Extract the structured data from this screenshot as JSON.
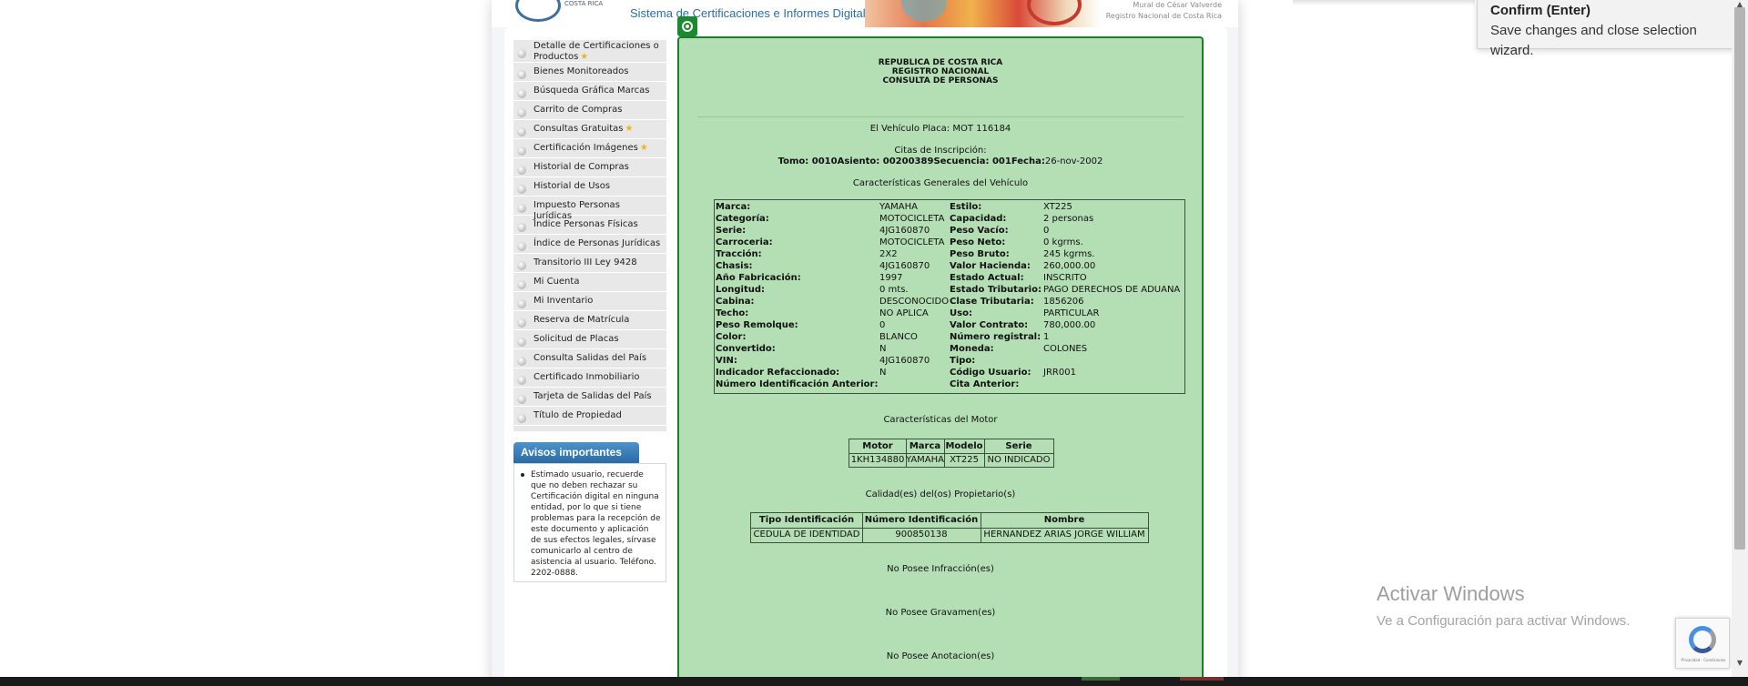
{
  "header": {
    "costa_rica": "COSTA RICA",
    "title": "Sistema de Certificaciones e Informes Digitales",
    "mural_line1": "Mural de César Valverde",
    "mural_line2": "Registro Nacional de Costa Rica"
  },
  "sidebar": {
    "items": [
      {
        "label": "Detalle de Certificaciones o Productos",
        "star": true
      },
      {
        "label": "Bienes Monitoreados",
        "star": false
      },
      {
        "label": "Búsqueda Gráfica Marcas",
        "star": false
      },
      {
        "label": "Carrito de Compras",
        "star": false
      },
      {
        "label": "Consultas Gratuitas",
        "star": true
      },
      {
        "label": "Certificación Imágenes",
        "star": true
      },
      {
        "label": "Historial de Compras",
        "star": false
      },
      {
        "label": "Historial de Usos",
        "star": false
      },
      {
        "label": "Impuesto Personas Jurídicas",
        "star": false
      },
      {
        "label": "Índice Personas Físicas",
        "star": false
      },
      {
        "label": "Índice de Personas Jurídicas",
        "star": false
      },
      {
        "label": "Transitorio III Ley 9428",
        "star": false
      },
      {
        "label": "Mi Cuenta",
        "star": false
      },
      {
        "label": "Mi Inventario",
        "star": false
      },
      {
        "label": "Reserva de Matrícula",
        "star": false
      },
      {
        "label": "Solicitud de Placas",
        "star": false
      },
      {
        "label": "Consulta Salidas del País",
        "star": false
      },
      {
        "label": "Certificado Inmobiliario",
        "star": false
      },
      {
        "label": "Tarjeta de Salidas del País",
        "star": false
      },
      {
        "label": "Título de Propiedad",
        "star": false
      }
    ]
  },
  "avisos": {
    "title": "Avisos importantes",
    "text": "Estimado usuario, recuerde que no deben rechazar su Certificación digital en ninguna entidad, por lo que si tiene problemas para la recepción de este documento y aplicación de sus efectos legales, sírvase comunicarlo al centro de asistencia al usuario. Teléfono. 2202-0888."
  },
  "report": {
    "header_line1": "REPUBLICA DE COSTA RICA",
    "header_line2": "REGISTRO NACIONAL",
    "header_line3": "CONSULTA DE PERSONAS",
    "vehicle_plate": "El Vehículo Placa: MOT 116184",
    "citas_label": "Citas de Inscripción:",
    "tomo_label": "Tomo: ",
    "tomo_value": "0010",
    "asiento_label": "Asiento: ",
    "asiento_value": "00200389",
    "secuencia_label": "Secuencia: ",
    "secuencia_value": "001",
    "fecha_label": "Fecha:",
    "fecha_value": "26-nov-2002",
    "general_title": "Características Generales del Vehículo",
    "general_left": [
      {
        "key": "Marca:",
        "value": "YAMAHA"
      },
      {
        "key": "Categoría:",
        "value": "MOTOCICLETA"
      },
      {
        "key": "Serie:",
        "value": "4JG160870"
      },
      {
        "key": "Carroceria:",
        "value": "MOTOCICLETA"
      },
      {
        "key": "Tracción:",
        "value": "2X2"
      },
      {
        "key": "Chasis:",
        "value": "4JG160870"
      },
      {
        "key": "Año Fabricación:",
        "value": "1997"
      },
      {
        "key": "Longitud:",
        "value": "0 mts."
      },
      {
        "key": "Cabina:",
        "value": "DESCONOCIDO"
      },
      {
        "key": "Techo:",
        "value": "NO APLICA"
      },
      {
        "key": "Peso Remolque:",
        "value": "0"
      },
      {
        "key": "Color:",
        "value": "BLANCO"
      },
      {
        "key": "Convertido:",
        "value": "N"
      },
      {
        "key": "VIN:",
        "value": "4JG160870"
      },
      {
        "key": "Indicador Refaccionado:",
        "value": "N"
      },
      {
        "key": "Número Identificación Anterior:",
        "value": ""
      }
    ],
    "general_right": [
      {
        "key": "Estilo:",
        "value": "XT225"
      },
      {
        "key": "Capacidad:",
        "value": "2 personas"
      },
      {
        "key": "Peso Vacío:",
        "value": "0"
      },
      {
        "key": "Peso Neto:",
        "value": "0 kgrms."
      },
      {
        "key": "Peso Bruto:",
        "value": "245 kgrms."
      },
      {
        "key": "Valor Hacienda:",
        "value": "260,000.00"
      },
      {
        "key": "Estado Actual:",
        "value": "INSCRITO"
      },
      {
        "key": "Estado Tributario:",
        "value": "PAGO DERECHOS DE ADUANA"
      },
      {
        "key": "Clase Tributaria:",
        "value": "1856206"
      },
      {
        "key": "Uso:",
        "value": "PARTICULAR"
      },
      {
        "key": "Valor Contrato:",
        "value": "780,000.00"
      },
      {
        "key": "Número registral:",
        "value": "1"
      },
      {
        "key": "Moneda:",
        "value": "COLONES"
      },
      {
        "key": "Tipo:",
        "value": ""
      },
      {
        "key": "Código Usuario:",
        "value": "JRR001"
      },
      {
        "key": "Cita Anterior:",
        "value": ""
      }
    ],
    "motor_title": "Características del Motor",
    "motor_headers": [
      "Motor",
      "Marca",
      "Modelo",
      "Serie"
    ],
    "motor_row": [
      "1KH134880",
      "YAMAHA",
      "XT225",
      "NO INDICADO"
    ],
    "owner_title": "Calidad(es) del(os) Propietario(s)",
    "owner_headers": [
      "Tipo Identificación",
      "Número Identificación",
      "Nombre"
    ],
    "owner_row": [
      "CEDULA DE IDENTIDAD",
      "900850138",
      "HERNANDEZ ARIAS JORGE WILLIAM"
    ],
    "infracciones": "No Posee Infracción(es)",
    "gravamenes": "No Posee Gravamen(es)",
    "anotaciones": "No Posee Anotacion(es)"
  },
  "tooltip": {
    "title": "Confirm (Enter)",
    "description": "Save changes and close selection wizard."
  },
  "windows_watermark": {
    "title": "Activar Windows",
    "subtitle": "Ve a Configuración para activar Windows."
  },
  "recaptcha": {
    "text": "Privacidad - Condiciones"
  },
  "colors": {
    "report_bg": "#b4deb4",
    "report_border": "#1d7d2a",
    "accent_blue": "#2a6eb0",
    "avisos_tab": "#2a6aa5",
    "star": "#f1b31c"
  }
}
